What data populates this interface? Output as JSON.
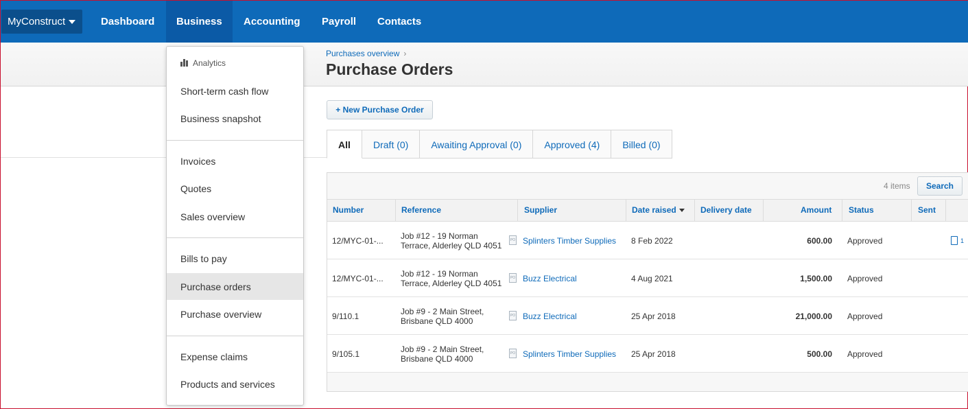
{
  "nav": {
    "org": "MyConstruct",
    "items": [
      "Dashboard",
      "Business",
      "Accounting",
      "Payroll",
      "Contacts"
    ]
  },
  "page": {
    "breadcrumb": "Purchases overview",
    "breadcrumb_sep": "›",
    "title": "Purchase Orders",
    "new_button": "+ New Purchase Order"
  },
  "tabs": [
    "All",
    "Draft (0)",
    "Awaiting Approval (0)",
    "Approved (4)",
    "Billed (0)"
  ],
  "table": {
    "count": "4 items",
    "search": "Search",
    "headers": [
      "Number",
      "Reference",
      "Supplier",
      "Date raised",
      "Delivery date",
      "Amount",
      "Status",
      "Sent"
    ],
    "rows": [
      {
        "number": "12/MYC-01-...",
        "ref1": "Job #12 - 19 Norman",
        "ref2": "Terrace, Alderley QLD 4051",
        "supplier": "Splinters Timber Supplies",
        "date": "8 Feb 2022",
        "amount": "600.00",
        "status": "Approved",
        "sent": "1"
      },
      {
        "number": "12/MYC-01-...",
        "ref1": "Job #12 - 19 Norman",
        "ref2": "Terrace, Alderley QLD 4051",
        "supplier": "Buzz Electrical",
        "date": "4 Aug 2021",
        "amount": "1,500.00",
        "status": "Approved"
      },
      {
        "number": "9/110.1",
        "ref1": "Job #9 - 2 Main Street,",
        "ref2": "Brisbane QLD 4000",
        "supplier": "Buzz Electrical",
        "date": "25 Apr 2018",
        "amount": "21,000.00",
        "status": "Approved"
      },
      {
        "number": "9/105.1",
        "ref1": "Job #9 - 2 Main Street,",
        "ref2": "Brisbane QLD 4000",
        "supplier": "Splinters Timber Supplies",
        "date": "25 Apr 2018",
        "amount": "500.00",
        "status": "Approved"
      }
    ]
  },
  "menu": {
    "heading": "Analytics",
    "groups": [
      [
        "Short-term cash flow",
        "Business snapshot"
      ],
      [
        "Invoices",
        "Quotes",
        "Sales overview"
      ],
      [
        "Bills to pay",
        "Purchase orders",
        "Purchase overview"
      ],
      [
        "Expense claims",
        "Products and services"
      ]
    ],
    "highlighted": "Purchase orders"
  },
  "colors": {
    "nav_bg": "#0e6ab9",
    "link": "#0e6ab9",
    "frame": "#c8102e"
  }
}
